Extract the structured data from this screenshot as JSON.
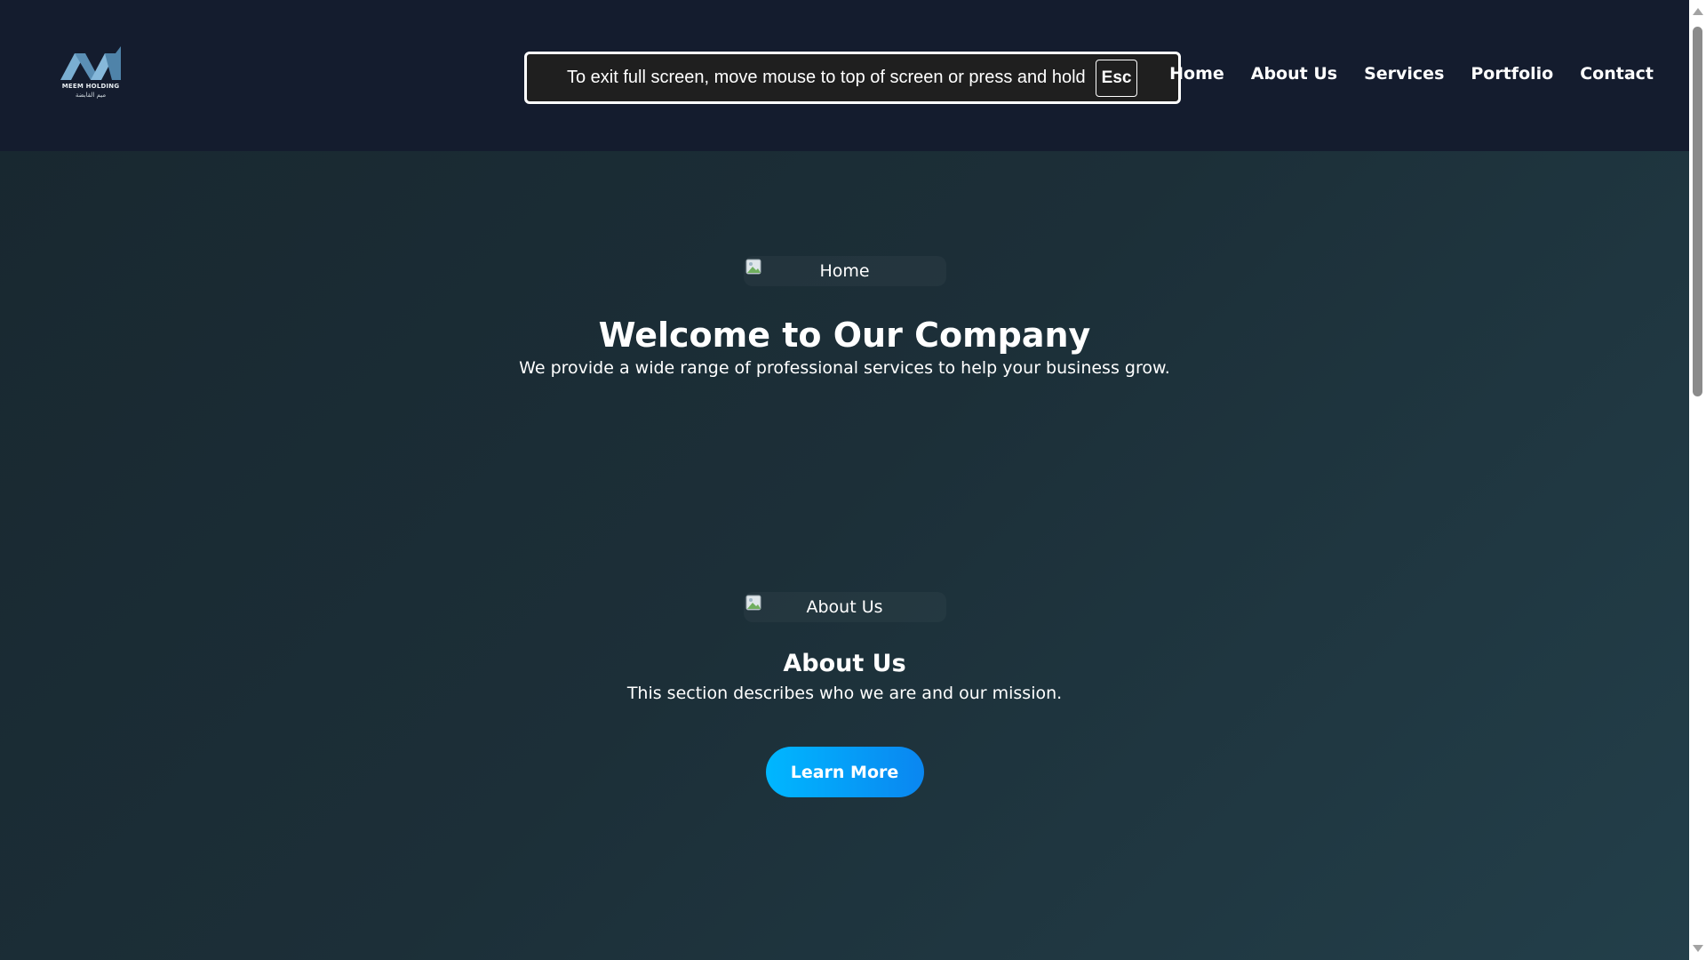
{
  "brand": {
    "logo_name": "MEEM HOLDING",
    "logo_name_ar": "ميم القابضة"
  },
  "fullscreen_notice": {
    "text": "To exit full screen, move mouse to top of screen or press and hold",
    "key": "Esc"
  },
  "nav": {
    "items": [
      "Home",
      "About Us",
      "Services",
      "Portfolio",
      "Contact"
    ]
  },
  "home_section": {
    "image_alt": "Home",
    "title": "Welcome to Our Company",
    "subtitle": "We provide a wide range of professional services to help your business grow."
  },
  "about_section": {
    "image_alt": "About Us",
    "title": "About Us",
    "subtitle": "This section describes who we are and our mission.",
    "button_label": "Learn More"
  },
  "colors": {
    "header_bg": "#141c2e",
    "accent": "#00b7ff",
    "logo_blue": "#6fa3c7"
  },
  "scrollbar": {
    "position_fraction": 0.0
  }
}
